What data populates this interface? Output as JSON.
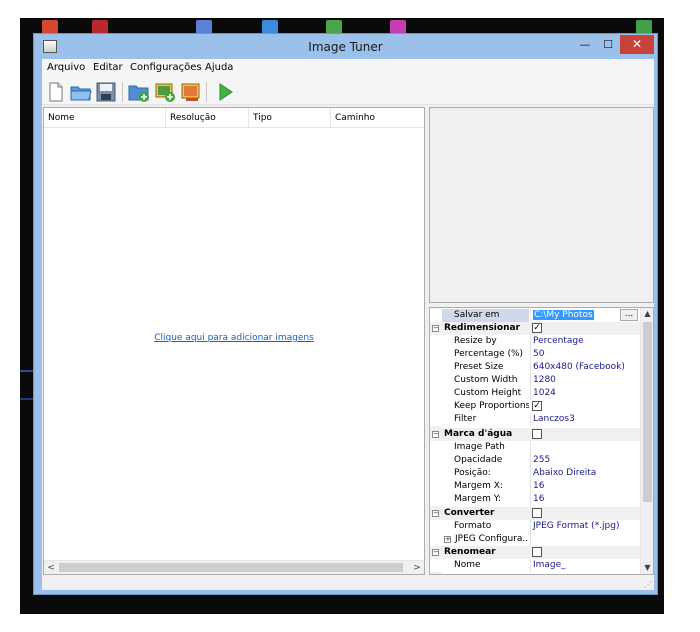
{
  "window": {
    "title": "Image Tuner",
    "minimize_glyph": "—",
    "maximize_glyph": "☐",
    "close_glyph": "✕"
  },
  "menu": {
    "items": [
      "Arquivo",
      "Editar",
      "Configurações",
      "Ajuda"
    ]
  },
  "toolbar": {
    "buttons": [
      "new-file-icon",
      "open-folder-icon",
      "save-icon",
      "add-folder-icon",
      "add-images-icon",
      "remove-images-icon",
      "run-play-icon"
    ]
  },
  "list": {
    "columns": [
      "Nome",
      "Resolução",
      "Tipo",
      "Caminho"
    ],
    "empty_link": "Clique aqui para adicionar imagens"
  },
  "scroll": {
    "left": "<",
    "right": ">",
    "up": "▲",
    "down": "▼"
  },
  "properties": {
    "salvar_em": {
      "label": "Salvar em",
      "value": "C:\\My Photos",
      "browse": "..."
    },
    "redimensionar": {
      "label": "Redimensionar",
      "checked": true,
      "items": [
        {
          "label": "Resize by",
          "value": "Percentage"
        },
        {
          "label": "Percentage (%)",
          "value": "50"
        },
        {
          "label": "Preset Size",
          "value": "640x480 (Facebook)"
        },
        {
          "label": "Custom Width",
          "value": "1280"
        },
        {
          "label": "Custom Height",
          "value": "1024"
        },
        {
          "label": "Keep Proportions",
          "value": ""
        },
        {
          "label": "Filter",
          "value": "Lanczos3"
        }
      ]
    },
    "marca_dagua": {
      "label": "Marca d'água",
      "checked": false,
      "items": [
        {
          "label": "Image Path",
          "value": ""
        },
        {
          "label": "Opacidade",
          "value": "255"
        },
        {
          "label": "Posição:",
          "value": "Abaixo Direita"
        },
        {
          "label": "Margem X:",
          "value": "16"
        },
        {
          "label": "Margem Y:",
          "value": "16"
        }
      ]
    },
    "converter": {
      "label": "Converter",
      "checked": false,
      "items": [
        {
          "label": "Formato",
          "value": "JPEG Format (*.jpg)"
        },
        {
          "label": "JPEG Configura...",
          "value": ""
        }
      ]
    },
    "renomear": {
      "label": "Renomear",
      "checked": false,
      "items": [
        {
          "label": "Nome",
          "value": "Image_"
        }
      ]
    },
    "keep_proportions_checked": true,
    "expander_collapsed": "+",
    "expander_expanded": "−",
    "check_glyph": "✓"
  },
  "colors": {
    "titlebar": "#9bc0ea",
    "close": "#c7423b",
    "link": "#1c5fb8",
    "value_text": "#1a1a8a",
    "selection": "#3399ff"
  }
}
